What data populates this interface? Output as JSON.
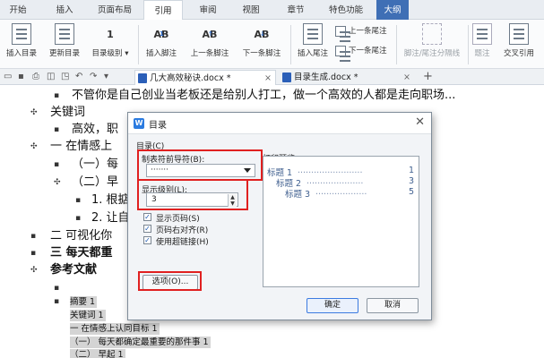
{
  "ribbon_tabs": [
    "开始",
    "插入",
    "页面布局",
    "引用",
    "审阅",
    "视图",
    "章节",
    "特色功能",
    "大纲"
  ],
  "toolbar": {
    "insert_toc": "插入目录",
    "update_toc": "更新目录",
    "toc_level": "目录级别",
    "insert_footnote": "插入脚注",
    "prev_footnote": "上一条脚注",
    "next_footnote": "下一条脚注",
    "insert_endnote": "插入尾注",
    "prev_endnote": "上一条尾注",
    "next_endnote": "下一条尾注",
    "separator": "脚注/尾注分隔线",
    "caption": "题注",
    "crossref": "交叉引用"
  },
  "doc_tabs": [
    "几大高效秘诀.docx *",
    "目录生成.docx *"
  ],
  "document": {
    "line1": "不管你是自己创业当老板还是给别人打工，做一个高效的人都是走向职场...",
    "h_keywords": "关键词",
    "keywords_body": "高效，职",
    "h1": "一 在情感上",
    "h1_1": "（一）每",
    "h1_2": "（二）早",
    "h1_2_1": "1. 根掂",
    "h1_2_2": "2. 让自",
    "h2": "二 可视化你",
    "h3": "三 每天都重",
    "h_refs": "参考文献",
    "toc_lines": [
      "摘要    1",
      "关键词    1",
      "一 在情感上认同目标    1",
      "（一） 每天都确定最重要的那件事    1",
      "（二） 早起    1"
    ]
  },
  "dialog": {
    "title": "目录",
    "group_label": "目录(C)",
    "leader_label": "制表符前导符(B):",
    "leader_value": "·······",
    "preview_label": "打印预览",
    "levels_label": "显示级别(L):",
    "levels_value": "3",
    "show_page": "显示页码(S)",
    "right_align": "页码右对齐(R)",
    "use_links": "使用超链接(H)",
    "options_btn": "选项(O)...",
    "ok_btn": "确定",
    "cancel_btn": "取消",
    "preview_entries": [
      {
        "text": "标题 1",
        "page": "1"
      },
      {
        "text": "标题 2",
        "page": "3"
      },
      {
        "text": "标题 3",
        "page": "5"
      }
    ]
  }
}
